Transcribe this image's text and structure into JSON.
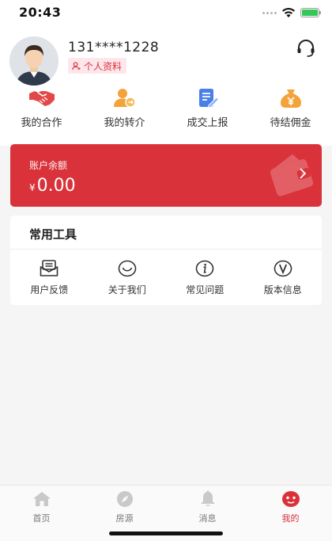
{
  "status_bar": {
    "time": "20:43"
  },
  "profile": {
    "username": "131****1228",
    "profile_tag_label": "个人资料"
  },
  "quick_actions": [
    {
      "label": "我的合作",
      "icon": "handshake-icon"
    },
    {
      "label": "我的转介",
      "icon": "referral-person-icon"
    },
    {
      "label": "成交上报",
      "icon": "report-document-icon"
    },
    {
      "label": "待结佣金",
      "icon": "money-bag-icon"
    }
  ],
  "balance": {
    "label": "账户余额",
    "currency": "¥",
    "amount": "0.00"
  },
  "tools": {
    "title": "常用工具",
    "items": [
      {
        "label": "用户反馈",
        "icon": "feedback-mail-icon"
      },
      {
        "label": "关于我们",
        "icon": "smile-icon"
      },
      {
        "label": "常见问题",
        "icon": "info-icon"
      },
      {
        "label": "版本信息",
        "icon": "version-icon"
      }
    ]
  },
  "tab_bar": {
    "tabs": [
      {
        "label": "首页",
        "icon": "home-icon"
      },
      {
        "label": "房源",
        "icon": "compass-icon"
      },
      {
        "label": "消息",
        "icon": "bell-icon"
      },
      {
        "label": "我的",
        "icon": "profile-robot-icon",
        "active": true
      }
    ]
  },
  "colors": {
    "accent": "#d9323a",
    "tag_background": "#fde7ea",
    "icon_orange": "#f4a23a",
    "icon_blue": "#4a7ee8",
    "icon_red": "#e2474a",
    "battery_green": "#34c759"
  }
}
